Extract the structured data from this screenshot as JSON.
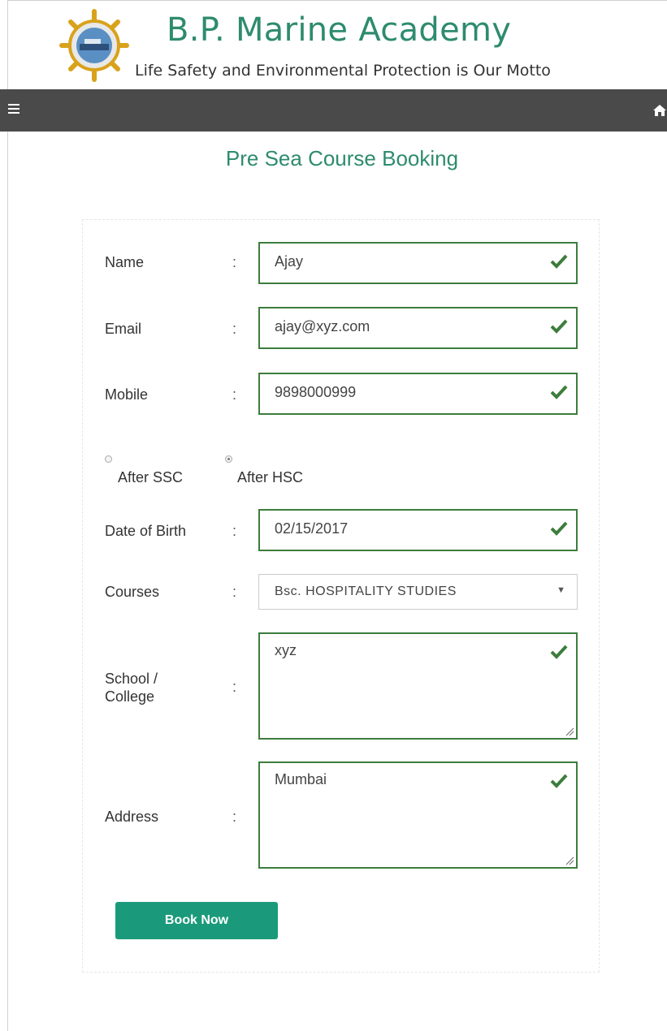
{
  "header": {
    "title": "B.P. Marine Academy",
    "motto": "Life Safety and Environmental Protection is Our Motto"
  },
  "navbar": {
    "menu_icon": "hamburger-menu-icon",
    "home_icon": "home-icon",
    "background": "#4a4a4a"
  },
  "page": {
    "title": "Pre Sea Course Booking"
  },
  "form": {
    "name": {
      "label": "Name",
      "value": "Ajay"
    },
    "email": {
      "label": "Email",
      "value": "ajay@xyz.com"
    },
    "mobile": {
      "label": "Mobile",
      "value": "9898000999"
    },
    "qualification": {
      "options": [
        {
          "label": "After SSC",
          "checked": false
        },
        {
          "label": "After HSC",
          "checked": true
        }
      ]
    },
    "dob": {
      "label": "Date of Birth",
      "value": "02/15/2017"
    },
    "courses": {
      "label": "Courses",
      "value": "Bsc. HOSPITALITY STUDIES"
    },
    "school": {
      "label_line1": "School /",
      "label_line2": "College",
      "value": "xyz"
    },
    "address": {
      "label": "Address",
      "value": "Mumbai"
    },
    "colon": ":",
    "submit_label": "Book Now"
  },
  "colors": {
    "accent": "#2e8b6e",
    "valid_border": "#3c7d3c",
    "button": "#1a9a7a"
  }
}
